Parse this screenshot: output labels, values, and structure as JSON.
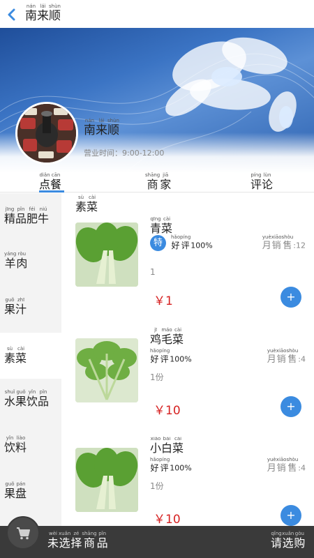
{
  "header": {
    "title": "南来顺",
    "title_pinyin": [
      "nán",
      "lái",
      "shùn"
    ]
  },
  "shop": {
    "name": "南来顺",
    "name_pinyin": [
      "nán",
      "lái",
      "shùn"
    ],
    "hours": "营业时间：9:00-12:00"
  },
  "tabs": [
    {
      "label": [
        "点",
        "餐"
      ],
      "pinyin": [
        "diǎn",
        "cān"
      ],
      "active": true
    },
    {
      "label": [
        "商",
        "家"
      ],
      "pinyin": [
        "shāng",
        "jiā"
      ],
      "active": false
    },
    {
      "label": [
        "评",
        "论"
      ],
      "pinyin": [
        "píng",
        "lùn"
      ],
      "active": false
    }
  ],
  "categories": [
    {
      "label": [
        "精",
        "品",
        "肥",
        "牛"
      ],
      "pinyin": [
        "jīng",
        "pǐn",
        "féi",
        "niú"
      ],
      "active": false
    },
    {
      "label": [
        "羊",
        "肉"
      ],
      "pinyin": [
        "yáng",
        "ròu"
      ],
      "active": false
    },
    {
      "label": [
        "果",
        "汁"
      ],
      "pinyin": [
        "guǒ",
        "zhī"
      ],
      "active": false
    },
    {
      "label": [
        "素",
        "菜"
      ],
      "pinyin": [
        "sù",
        "cài"
      ],
      "active": true
    },
    {
      "label": [
        "水",
        "果",
        "饮",
        "品"
      ],
      "pinyin": [
        "shuǐ",
        "guǒ",
        "yǐn",
        "pǐn"
      ],
      "active": false
    },
    {
      "label": [
        "饮",
        "料"
      ],
      "pinyin": [
        "yǐn",
        "liào"
      ],
      "active": false
    },
    {
      "label": [
        "果",
        "盘"
      ],
      "pinyin": [
        "guǒ",
        "pán"
      ],
      "active": false
    }
  ],
  "section": {
    "title": [
      "素",
      "菜"
    ],
    "pinyin": [
      "sù",
      "cài"
    ]
  },
  "products": [
    {
      "name": [
        "青",
        "菜"
      ],
      "name_pinyin": [
        "qīng",
        "cài"
      ],
      "special_badge": "特",
      "rating_label": [
        "好",
        "评"
      ],
      "rating_pinyin": [
        "hǎo",
        "píng"
      ],
      "rating_value": "100%",
      "sales_label": [
        "月",
        "销",
        "售"
      ],
      "sales_pinyin": [
        "yuè",
        "xiāo",
        "shòu"
      ],
      "sales_value": ":12",
      "unit": "1",
      "price": "￥1",
      "add_label": "+"
    },
    {
      "name": [
        "鸡",
        "毛",
        "菜"
      ],
      "name_pinyin": [
        "jī",
        "máo",
        "cài"
      ],
      "special_badge": "",
      "rating_label": [
        "好",
        "评"
      ],
      "rating_pinyin": [
        "hǎo",
        "píng"
      ],
      "rating_value": "100%",
      "sales_label": [
        "月",
        "销",
        "售"
      ],
      "sales_pinyin": [
        "yuè",
        "xiāo",
        "shòu"
      ],
      "sales_value": ":4",
      "unit": "1份",
      "price": "￥10",
      "add_label": "+"
    },
    {
      "name": [
        "小",
        "白",
        "菜"
      ],
      "name_pinyin": [
        "xiǎo",
        "bái",
        "cài"
      ],
      "special_badge": "",
      "rating_label": [
        "好",
        "评"
      ],
      "rating_pinyin": [
        "hǎo",
        "píng"
      ],
      "rating_value": "100%",
      "sales_label": [
        "月",
        "销",
        "售"
      ],
      "sales_pinyin": [
        "yuè",
        "xiāo",
        "shòu"
      ],
      "sales_value": ":4",
      "unit": "1份",
      "price": "￥10",
      "add_label": "+"
    }
  ],
  "bottom_bar": {
    "selected_text": [
      "未",
      "选",
      "择",
      "商",
      "品"
    ],
    "selected_pinyin": [
      "wèi",
      "xuǎn",
      "zé",
      "shāng",
      "pǐn"
    ],
    "checkout": [
      "请",
      "选",
      "购"
    ],
    "checkout_pinyin": [
      "qǐng",
      "xuǎn",
      "gòu"
    ]
  },
  "colors": {
    "accent": "#3b8be0",
    "price": "#d62222",
    "bottom_bar": "#3a3a3a"
  }
}
